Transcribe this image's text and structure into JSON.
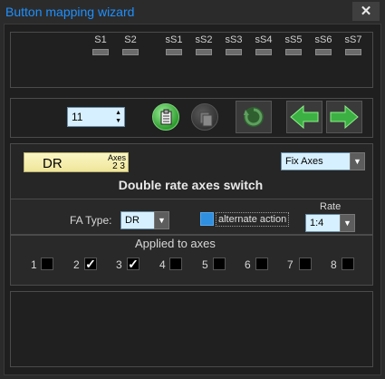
{
  "window": {
    "title": "Button mapping wizard",
    "close_label": "✕"
  },
  "switches": [
    {
      "label": "S1"
    },
    {
      "label": "S2"
    },
    {
      "label": "sS1"
    },
    {
      "label": "sS2"
    },
    {
      "label": "sS3"
    },
    {
      "label": "sS4"
    },
    {
      "label": "sS5"
    },
    {
      "label": "sS6"
    },
    {
      "label": "sS7"
    }
  ],
  "toolbar": {
    "index_value": "11"
  },
  "detail": {
    "name": "DR",
    "axes_label": "Axes",
    "axes_value": "2 3",
    "mode_select": "Fix Axes",
    "description": "Double rate axes switch",
    "fa_type_label": "FA Type:",
    "fa_type_value": "DR",
    "alternate_label": "alternate action",
    "rate_label": "Rate",
    "rate_value": "1:4",
    "applied_label": "Applied to axes",
    "axes": [
      {
        "num": "1",
        "checked": false
      },
      {
        "num": "2",
        "checked": true
      },
      {
        "num": "3",
        "checked": true
      },
      {
        "num": "4",
        "checked": false
      },
      {
        "num": "5",
        "checked": false
      },
      {
        "num": "6",
        "checked": false
      },
      {
        "num": "7",
        "checked": false
      },
      {
        "num": "8",
        "checked": false
      }
    ]
  },
  "icons": {
    "paste": "paste-icon",
    "copy": "copy-icon",
    "refresh": "refresh-icon",
    "back": "arrow-left-icon",
    "forward": "arrow-right-icon"
  },
  "colors": {
    "title": "#1e90ff",
    "green": "#3cb043",
    "field_bg": "#d7f0ff",
    "highlight": "#2f8fe0"
  }
}
